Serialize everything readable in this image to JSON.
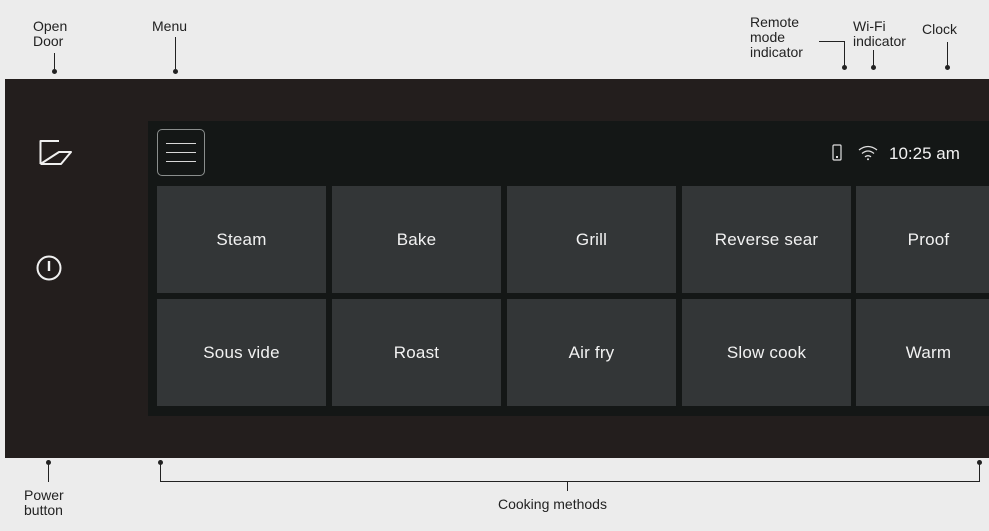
{
  "callouts": {
    "open_door": "Open\nDoor",
    "menu": "Menu",
    "remote_mode": "Remote\nmode\nindicator",
    "wifi": "Wi-Fi\nindicator",
    "clock": "Clock",
    "power": "Power\nbutton",
    "cooking_methods": "Cooking methods"
  },
  "status_bar": {
    "time": "10:25 am",
    "remote_icon": "phone-icon",
    "wifi_icon": "wifi-icon"
  },
  "side_controls": {
    "door_icon": "open-door-icon",
    "power_icon": "power-icon"
  },
  "cooking_methods": [
    [
      "Steam",
      "Bake",
      "Grill",
      "Reverse sear",
      "Proof"
    ],
    [
      "Sous vide",
      "Roast",
      "Air fry",
      "Slow cook",
      "Warm"
    ]
  ],
  "colors": {
    "panel": "#231e1d",
    "screen": "#141716",
    "tile": "#333637",
    "text": "#f2f2f2"
  }
}
